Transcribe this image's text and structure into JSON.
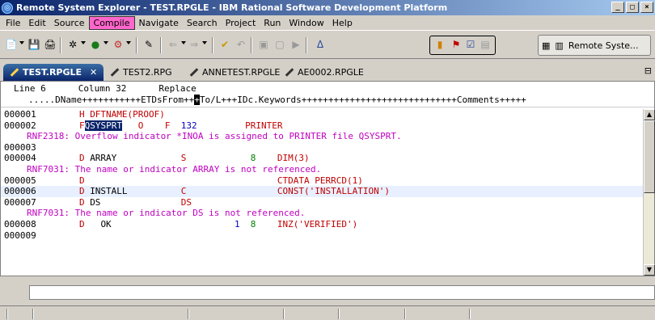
{
  "window": {
    "title": "Remote System Explorer - TEST.RPGLE - IBM Rational Software Development Platform"
  },
  "menu": [
    "File",
    "Edit",
    "Source",
    "Compile",
    "Navigate",
    "Search",
    "Project",
    "Run",
    "Window",
    "Help"
  ],
  "perspective": {
    "label": "Remote Syste..."
  },
  "tabs": [
    {
      "label": "TEST.RPGLE",
      "active": true
    },
    {
      "label": "TEST2.RPG",
      "active": false
    },
    {
      "label": "ANNETEST.RPGLE",
      "active": false
    },
    {
      "label": "AE0002.RPGLE",
      "active": false
    }
  ],
  "editor": {
    "status": {
      "line": "Line 6",
      "column": "Column 32",
      "mode": "Replace"
    },
    "ruler_left": ".....DName+++++++++++ETDsFrom++",
    "ruler_cursor": "+",
    "ruler_right": "To/L+++IDc.Keywords+++++++++++++++++++++++++++++Comments+++++",
    "lines": [
      {
        "no": "000001",
        "tokens": [
          {
            "text": "H",
            "cls": "red",
            "col": 8
          },
          {
            "text": "DFTNAME(PROOF)",
            "cls": "red",
            "col": 10
          }
        ]
      },
      {
        "no": "000002",
        "tokens": [
          {
            "text": "F",
            "cls": "red",
            "col": 8
          },
          {
            "text": "QSYSPRT",
            "cls": "sel",
            "col": 9
          },
          {
            "text": "O",
            "cls": "red",
            "col": 19
          },
          {
            "text": "F",
            "cls": "red",
            "col": 24
          },
          {
            "text": "132",
            "cls": "blue",
            "col": 27
          },
          {
            "text": "PRINTER",
            "cls": "red",
            "col": 39
          }
        ]
      },
      {
        "msg": "RNF2318: Overflow indicator *INOA is assigned to PRINTER file QSYSPRT."
      },
      {
        "no": "000003",
        "tokens": []
      },
      {
        "no": "000004",
        "tokens": [
          {
            "text": "D",
            "cls": "red",
            "col": 8
          },
          {
            "text": "ARRAY",
            "cls": "",
            "col": 10
          },
          {
            "text": "S",
            "cls": "red",
            "col": 27
          },
          {
            "text": "8",
            "cls": "green",
            "col": 40
          },
          {
            "text": "DIM(3)",
            "cls": "red",
            "col": 45
          }
        ]
      },
      {
        "msg": "RNF7031: The name or indicator ARRAY is not referenced."
      },
      {
        "no": "000005",
        "tokens": [
          {
            "text": "D",
            "cls": "red",
            "col": 8
          },
          {
            "text": "CTDATA PERRCD(1)",
            "cls": "red",
            "col": 45
          }
        ]
      },
      {
        "no": "000006",
        "current": true,
        "tokens": [
          {
            "text": "D",
            "cls": "red",
            "col": 8
          },
          {
            "text": "INSTALL",
            "cls": "",
            "col": 10
          },
          {
            "text": "C",
            "cls": "red",
            "col": 27
          },
          {
            "text": "CONST('INSTALLATION')",
            "cls": "red",
            "col": 45
          }
        ]
      },
      {
        "no": "000007",
        "tokens": [
          {
            "text": "D",
            "cls": "red",
            "col": 8
          },
          {
            "text": "DS",
            "cls": "",
            "col": 10
          },
          {
            "text": "DS",
            "cls": "red",
            "col": 27
          }
        ]
      },
      {
        "msg": "RNF7031: The name or indicator DS is not referenced."
      },
      {
        "no": "000008",
        "tokens": [
          {
            "text": "D",
            "cls": "red",
            "col": 8
          },
          {
            "text": "OK",
            "cls": "",
            "col": 12
          },
          {
            "text": "1",
            "cls": "blue",
            "col": 37
          },
          {
            "text": "8",
            "cls": "green",
            "col": 40
          },
          {
            "text": "INZ('VERIFIED')",
            "cls": "red",
            "col": 45
          }
        ]
      },
      {
        "no": "000009",
        "tokens": []
      }
    ]
  }
}
